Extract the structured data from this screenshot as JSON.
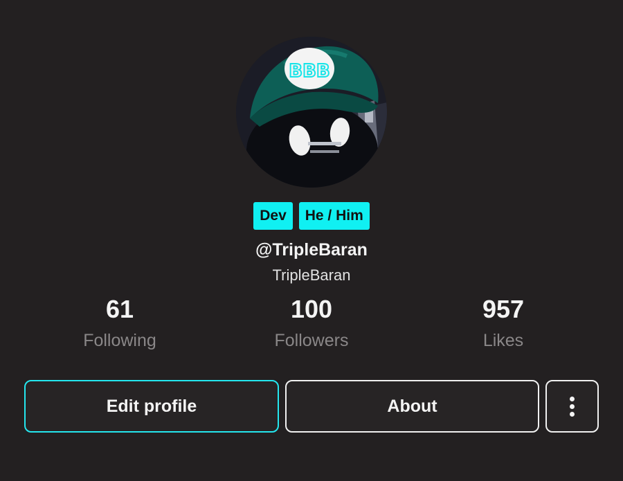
{
  "profile": {
    "avatar_icon": "green-cap-character-avatar",
    "cap_letters": "BBB",
    "badges": [
      "Dev",
      "He / Him"
    ],
    "handle": "@TripleBaran",
    "display_name": "TripleBaran"
  },
  "stats": {
    "following": {
      "value": "61",
      "label": "Following"
    },
    "followers": {
      "value": "100",
      "label": "Followers"
    },
    "likes": {
      "value": "957",
      "label": "Likes"
    }
  },
  "actions": {
    "edit_label": "Edit profile",
    "about_label": "About",
    "more_icon": "vertical-dots-icon"
  },
  "colors": {
    "background": "#232021",
    "accent": "#10f0f2",
    "edit_border": "#24e7ef"
  }
}
